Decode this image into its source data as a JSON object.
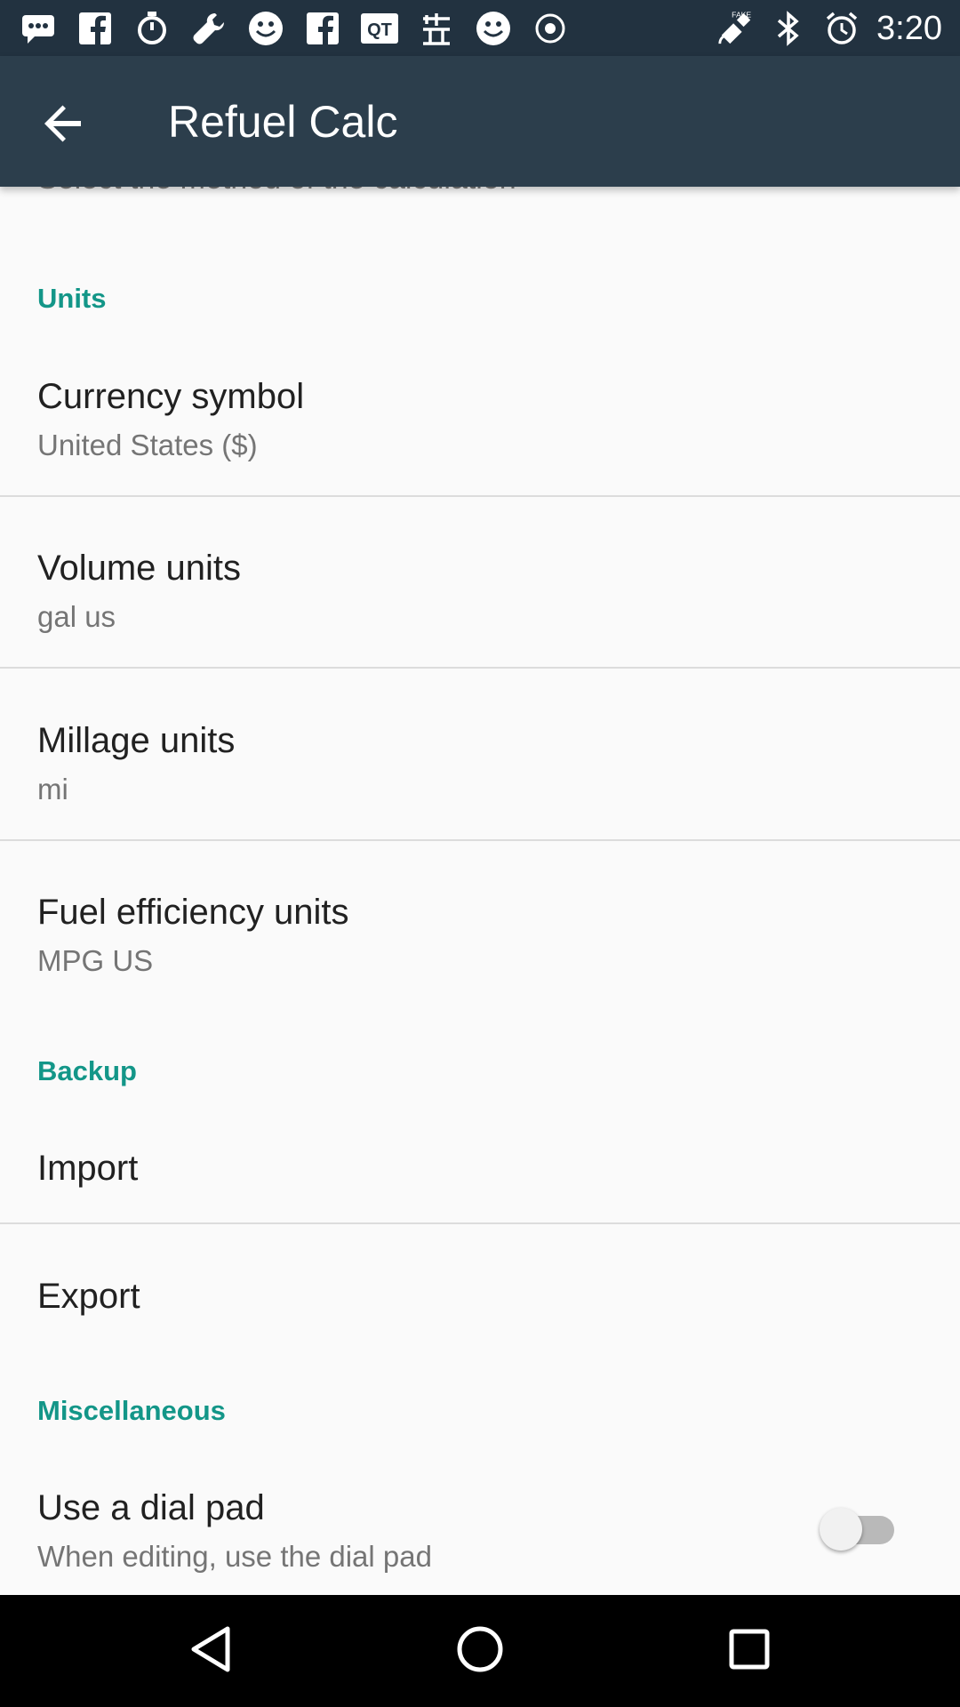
{
  "status_bar": {
    "time": "3:20",
    "left_icons": [
      "message-icon",
      "facebook-icon",
      "stopwatch-icon",
      "wrench-icon",
      "smiley-icon",
      "facebook-icon",
      "qt-icon",
      "chinese-app-icon",
      "smiley-icon",
      "vpn-icon"
    ],
    "right_icons": [
      "fake-gps-icon",
      "bluetooth-icon",
      "alarm-icon"
    ]
  },
  "app_bar": {
    "title": "Refuel Calc",
    "back_icon": "arrow-back-icon"
  },
  "content": {
    "cut_off_text": "Select the method of the calculation",
    "sections": {
      "units": {
        "header": "Units",
        "items": [
          {
            "title": "Currency symbol",
            "summary": "United States ($)"
          },
          {
            "title": "Volume units",
            "summary": "gal us"
          },
          {
            "title": "Millage units",
            "summary": "mi"
          },
          {
            "title": "Fuel efficiency units",
            "summary": "MPG US"
          }
        ]
      },
      "backup": {
        "header": "Backup",
        "items": [
          {
            "title": "Import"
          },
          {
            "title": "Export"
          }
        ]
      },
      "misc": {
        "header": "Miscellaneous",
        "items": [
          {
            "title": "Use a dial pad",
            "summary": "When editing, use the dial pad",
            "toggle_on": false
          }
        ]
      }
    }
  },
  "nav_bar": {
    "icons": [
      "back-triangle-icon",
      "home-circle-icon",
      "recents-square-icon"
    ]
  },
  "colors": {
    "status_bar": "#223240",
    "app_bar": "#2c3e4c",
    "accent": "#139688",
    "background": "#fafafa"
  }
}
